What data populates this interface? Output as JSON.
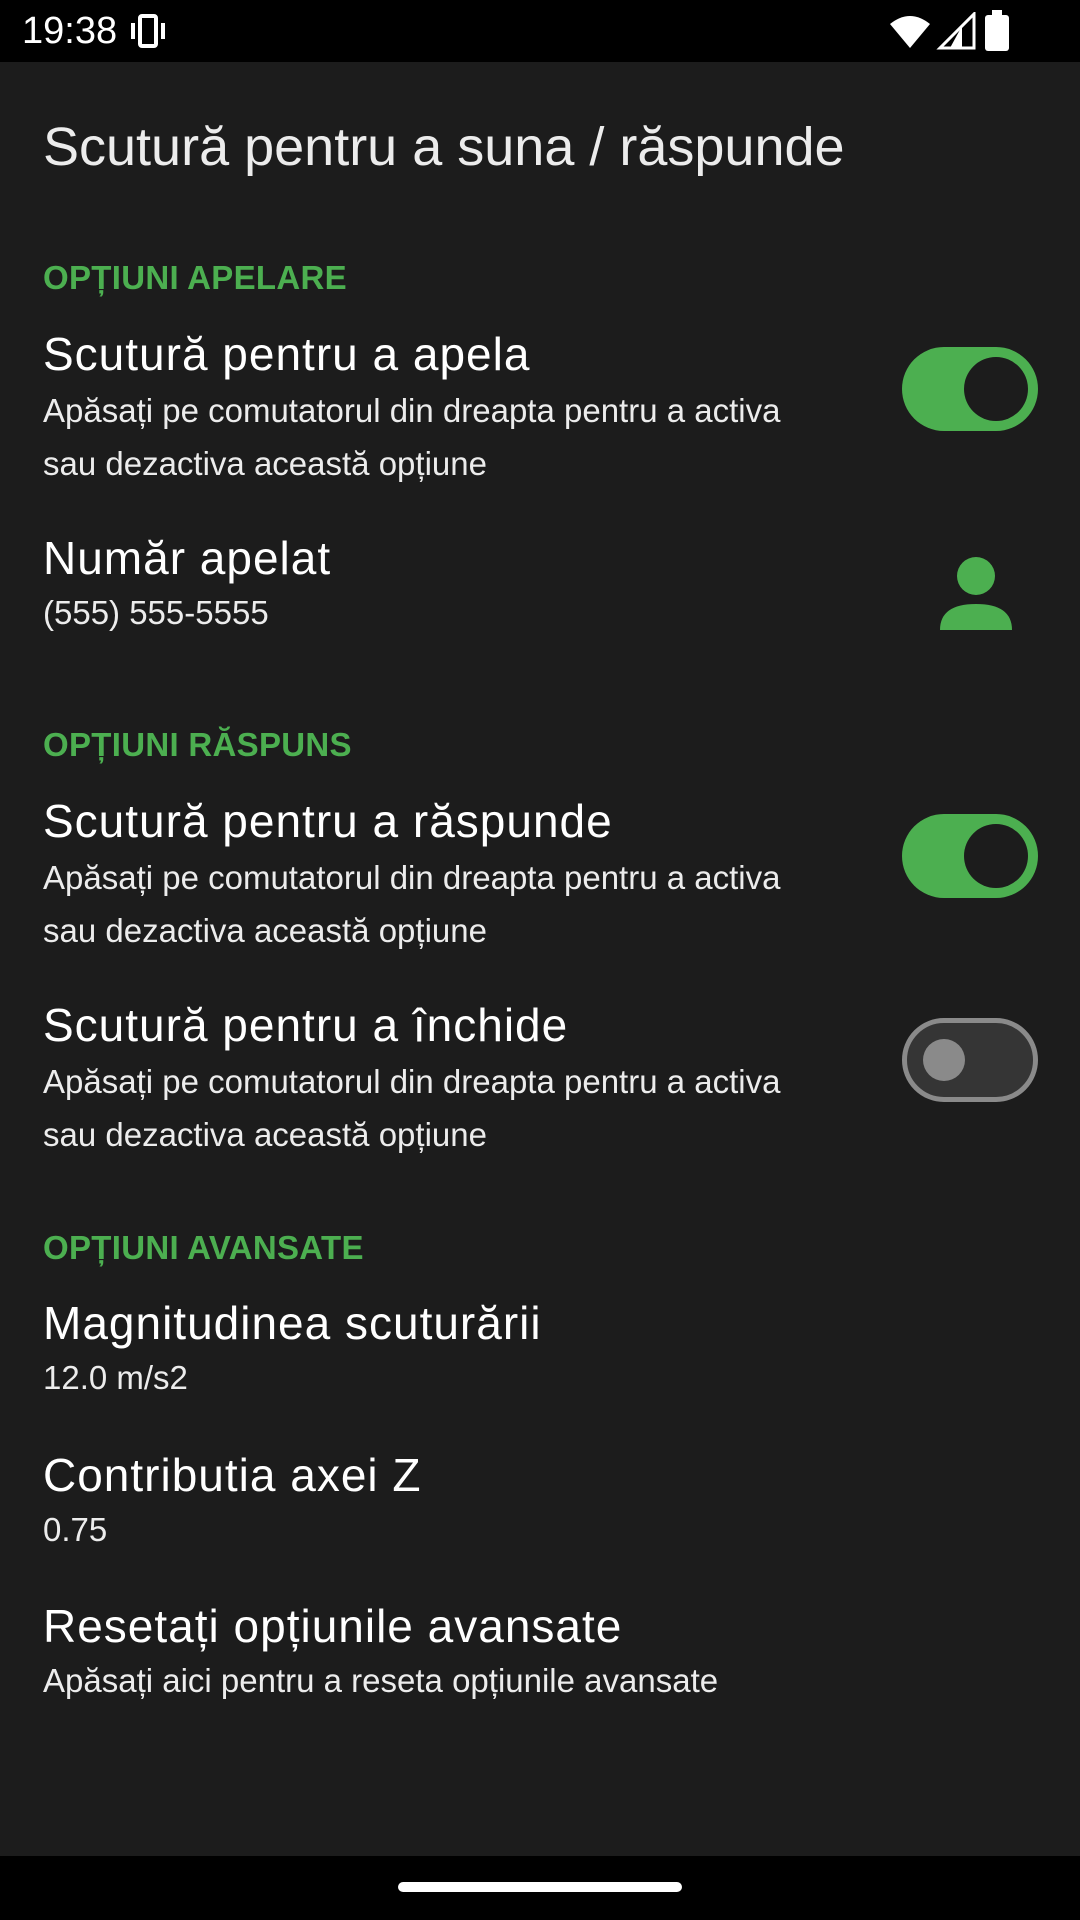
{
  "status_bar": {
    "time": "19:38",
    "icons": [
      "vibrate-icon",
      "wifi-icon",
      "signal-icon",
      "battery-icon"
    ]
  },
  "app": {
    "title": "Scutură pentru a suna / răspunde"
  },
  "colors": {
    "accent": "#4caf50",
    "background": "#1c1c1c",
    "status_bar": "#000000"
  },
  "sections": {
    "call": {
      "header": "OPȚIUNI APELARE",
      "shake_to_call": {
        "title": "Scutură pentru a apela",
        "summary": "Apăsați pe comutatorul din dreapta pentru a activa sau dezactiva această opțiune",
        "enabled": true
      },
      "number": {
        "title": "Număr apelat",
        "value": "(555) 555-5555",
        "icon": "contact-icon"
      }
    },
    "answer": {
      "header": "OPȚIUNI RĂSPUNS",
      "shake_to_answer": {
        "title": "Scutură pentru a răspunde",
        "summary": "Apăsați pe comutatorul din dreapta pentru a activa sau dezactiva această opțiune",
        "enabled": true
      },
      "shake_to_hangup": {
        "title": "Scutură pentru a închide",
        "summary": "Apăsați pe comutatorul din dreapta pentru a activa sau dezactiva această opțiune",
        "enabled": false
      }
    },
    "advanced": {
      "header": "OPȚIUNI AVANSATE",
      "magnitude": {
        "title": "Magnitudinea scuturării",
        "value": "12.0 m/s2"
      },
      "z_axis": {
        "title": "Contributia axei Z",
        "value": "0.75"
      },
      "reset": {
        "title": "Resetați opțiunile avansate",
        "summary": "Apăsați aici pentru a reseta opțiunile avansate"
      }
    }
  }
}
